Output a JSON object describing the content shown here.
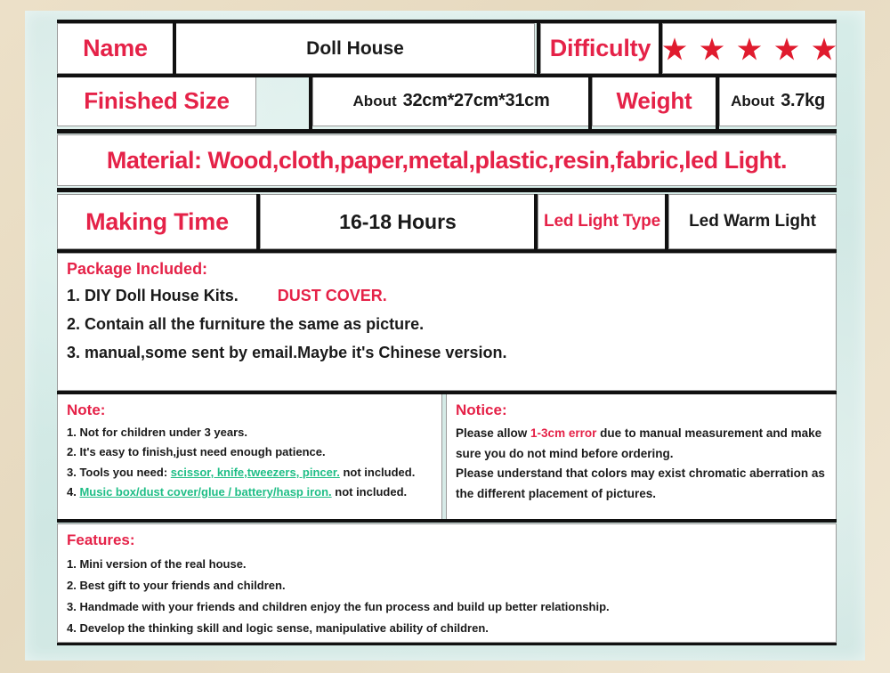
{
  "colors": {
    "accent_red": "#e52248",
    "accent_green": "#1fbe86",
    "text_black": "#1a1a1a",
    "mat_background": "#d3e8e4",
    "frame_background": "#e9ddc5"
  },
  "spec_rows": {
    "name_label": "Name",
    "name_value": "Doll House",
    "difficulty_label": "Difficulty",
    "difficulty_stars": 5,
    "size_label": "Finished Size",
    "size_about": "About",
    "size_value": "32cm*27cm*31cm",
    "weight_label": "Weight",
    "weight_about": "About",
    "weight_value": "3.7kg",
    "material": "Material: Wood,cloth,paper,metal,plastic,resin,fabric,led Light.",
    "making_time_label": "Making Time",
    "making_time_value": "16-18 Hours",
    "led_type_label": "Led Light Type",
    "led_type_value": "Led Warm Light"
  },
  "package": {
    "heading": "Package Included:",
    "item1_main": "1. DIY Doll House Kits.",
    "item1_highlight": "DUST COVER.",
    "item2": "2. Contain all the furniture the same as picture.",
    "item3": "3. manual,some sent by email.Maybe it's Chinese version."
  },
  "note": {
    "heading": "Note:",
    "item1": "1. Not for children under 3 years.",
    "item2": "2. It's easy to finish,just need enough patience.",
    "item3_prefix": "3. Tools you need: ",
    "item3_tools": "scissor, knife,tweezers, pincer.",
    "item3_suffix": " not included.",
    "item4_prefix": "4. ",
    "item4_items": "Music box/dust cover/glue / battery/hasp iron.",
    "item4_suffix": " not included."
  },
  "notice": {
    "heading": "Notice:",
    "line1_prefix": "Please allow ",
    "line1_highlight": "1-3cm error",
    "line1_suffix": " due to manual measurement and make",
    "line2": "sure you do not mind before ordering.",
    "line3": "Please understand that colors may exist chromatic aberration as",
    "line4": "the different placement of pictures."
  },
  "features": {
    "heading": "Features:",
    "item1": "1. Mini version of the real house.",
    "item2": "2. Best gift to your friends and children.",
    "item3": "3. Handmade with your friends and children enjoy the fun process and build up better relationship.",
    "item4": "4. Develop the thinking skill and logic sense, manipulative ability of children."
  }
}
